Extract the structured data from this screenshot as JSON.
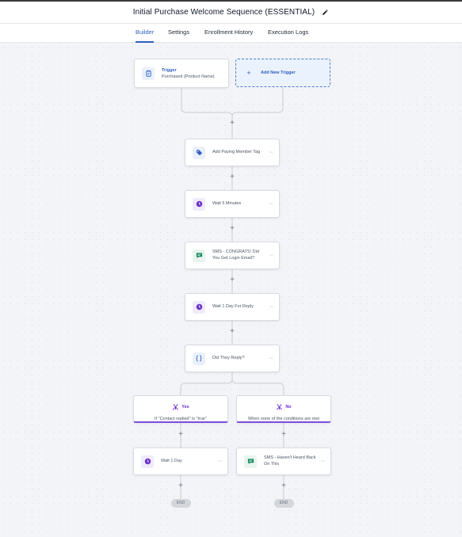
{
  "workflow": {
    "title": "Initial Purchase Welcome Sequence (ESSENTIAL)"
  },
  "tabs": [
    "Builder",
    "Settings",
    "Enrollment History",
    "Execution Logs"
  ],
  "active_tab": "Builder",
  "trigger": {
    "title": "Trigger",
    "subtitle": "Purchased (Product Name)",
    "add_label": "Add New Trigger"
  },
  "steps": [
    {
      "label": "Add Paying Member Tag",
      "icon": "tag-icon"
    },
    {
      "label": "Wait 5 Minutes",
      "icon": "clock-icon"
    },
    {
      "label": "SMS - CONGRATS! Did You Get Login Email?",
      "icon": "sms-icon"
    },
    {
      "label": "Wait 1 Day For Reply",
      "icon": "clock-icon"
    },
    {
      "label": "Did They Reply?",
      "icon": "condition-icon"
    }
  ],
  "branches": [
    {
      "name": "Yes",
      "description": "If \"Contact replied\" is \"true\"",
      "action": {
        "label": "Wait 1 Day",
        "icon": "clock-icon"
      },
      "end_label": "END"
    },
    {
      "name": "No",
      "description": "When none of the conditions are met",
      "action": {
        "label": "SMS - Haven't Heard Back On This",
        "icon": "sms-icon"
      },
      "end_label": "END"
    }
  ],
  "more_glyph": "···",
  "add_glyph": "+",
  "colors": {
    "accent": "#2f5fbf",
    "branch": "#7c4ddb",
    "wait": "#6d35c7",
    "sms": "#12865a",
    "tag": "#2f5fbf"
  }
}
